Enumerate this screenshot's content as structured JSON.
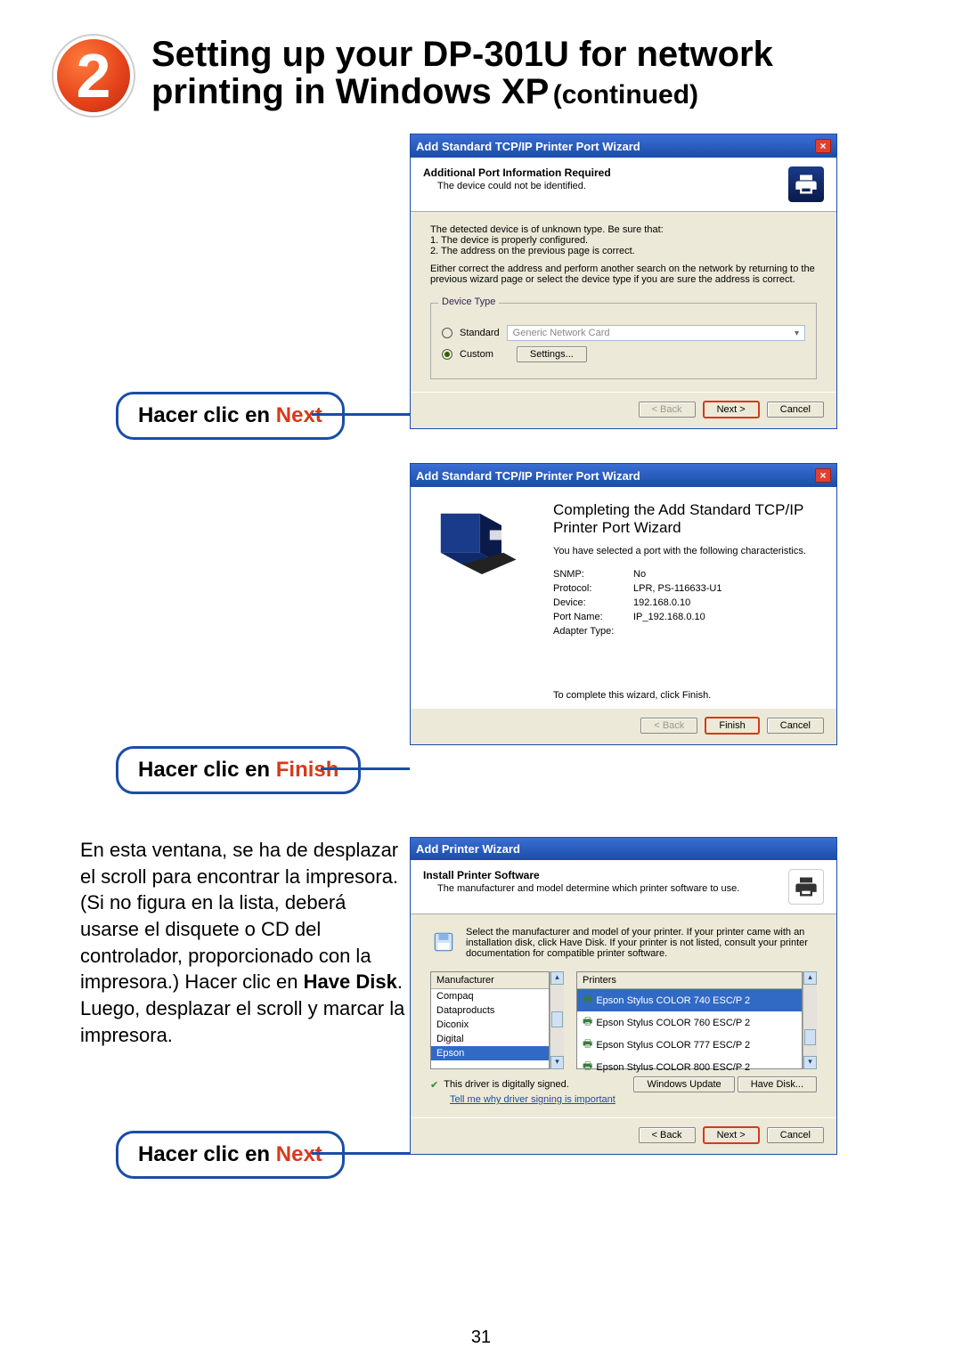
{
  "step_number": "2",
  "title_line1": "Setting up your DP-301U for network",
  "title_line2": "printing in Windows XP",
  "title_continued": "(continued)",
  "labels": {
    "click_next_1": {
      "prefix": "Hacer clic en ",
      "action": "Next"
    },
    "click_finish": {
      "prefix": "Hacer clic en ",
      "action": "Finish"
    },
    "click_next_2": {
      "prefix": "Hacer clic en ",
      "action": "Next"
    }
  },
  "paragraph": "En esta ventana, se ha de desplazar el scroll para encontrar la impresora. (Si no figura en la lista, deberá usarse el disquete o CD del controlador, proporcionado con la impresora.) Hacer clic en ",
  "paragraph_bold": "Have Disk",
  "paragraph_tail": ". Luego, desplazar el scroll y marcar la impresora.",
  "dialog1": {
    "title": "Add Standard TCP/IP Printer Port Wizard",
    "head_title": "Additional Port Information Required",
    "head_sub": "The device could not be identified.",
    "body1": "The detected device is of unknown type. Be sure that:",
    "body2": "1. The device is properly configured.",
    "body3": "2. The address on the previous page is correct.",
    "body4": "Either correct the address and perform another search on the network by returning to the previous wizard page or select the device type if you are sure the address is correct.",
    "group": "Device Type",
    "radio_standard": "Standard",
    "dropdown": "Generic Network Card",
    "radio_custom": "Custom",
    "settings_btn": "Settings...",
    "back": "< Back",
    "next": "Next >",
    "cancel": "Cancel"
  },
  "dialog2": {
    "title": "Add Standard TCP/IP Printer Port Wizard",
    "heading": "Completing the Add Standard TCP/IP Printer Port Wizard",
    "subhead": "You have selected a port with the following characteristics.",
    "kv": [
      {
        "k": "SNMP:",
        "v": "No"
      },
      {
        "k": "Protocol:",
        "v": "LPR,  PS-116633-U1"
      },
      {
        "k": "Device:",
        "v": "192.168.0.10"
      },
      {
        "k": "Port Name:",
        "v": "IP_192.168.0.10"
      },
      {
        "k": "Adapter Type:",
        "v": ""
      }
    ],
    "finish_hint": "To complete this wizard, click Finish.",
    "back": "< Back",
    "finish": "Finish",
    "cancel": "Cancel"
  },
  "dialog3": {
    "title": "Add Printer Wizard",
    "head_title": "Install Printer Software",
    "head_sub": "The manufacturer and model determine which printer software to use.",
    "instr": "Select the manufacturer and model of your printer. If your printer came with an installation disk, click Have Disk. If your printer is not listed, consult your printer documentation for compatible printer software.",
    "mfr_label": "Manufacturer",
    "prn_label": "Printers",
    "manufacturers": [
      "Compaq",
      "Dataproducts",
      "Diconix",
      "Digital",
      "Epson"
    ],
    "printers": [
      "Epson Stylus COLOR 740 ESC/P 2",
      "Epson Stylus COLOR 760 ESC/P 2",
      "Epson Stylus COLOR 777 ESC/P 2",
      "Epson Stylus COLOR 800 ESC/P 2"
    ],
    "signed": "This driver is digitally signed.",
    "signed_link": "Tell me why driver signing is important",
    "windows_update": "Windows Update",
    "have_disk": "Have Disk...",
    "back": "< Back",
    "next": "Next >",
    "cancel": "Cancel"
  },
  "page_number": "31"
}
